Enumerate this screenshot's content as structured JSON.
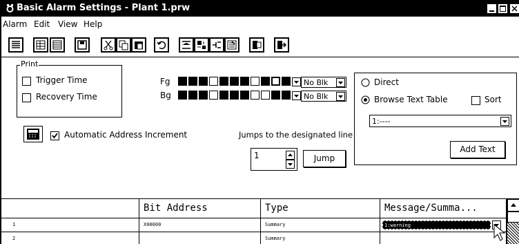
{
  "window": {
    "title": "Basic Alarm Settings - Plant 1.prw"
  },
  "menu": [
    "Alarm",
    "Edit",
    "View",
    "Help"
  ],
  "toolbar": {
    "icons": [
      "list-view-icon",
      "grid-view-icon",
      "table-view-icon",
      "save-icon",
      "cut-icon",
      "copy-icon",
      "paste-icon",
      "undo-icon",
      "insert-row-icon",
      "delete-row-icon",
      "jump-icon",
      "import-icon",
      "export-icon",
      "exit-icon"
    ]
  },
  "print": {
    "legend": "Print",
    "trigger_label": "Trigger Time",
    "recovery_label": "Recovery Time",
    "trigger_checked": false,
    "recovery_checked": false
  },
  "colors": {
    "fg_label": "Fg",
    "bg_label": "Bg",
    "fg_blink": "No Blk",
    "bg_blink": "No Blk"
  },
  "auto_increment": {
    "label": "Automatic Address Increment",
    "checked": true
  },
  "jump": {
    "label": "Jumps to the designated line",
    "value": "1",
    "button": "Jump"
  },
  "text_source": {
    "direct_label": "Direct",
    "browse_label": "Browse Text Table",
    "selected": "browse",
    "sort_label": "Sort",
    "sort_checked": false,
    "table_value": "1:----",
    "add_text_button": "Add Text"
  },
  "table": {
    "headers": [
      "",
      "Bit Address",
      "Type",
      "Message/Summa..."
    ],
    "rows": [
      {
        "num": "1",
        "address": "X00000",
        "type": "Summary",
        "message": "1:warning"
      },
      {
        "num": "2",
        "address": "",
        "type": "Summary",
        "message": ""
      }
    ]
  }
}
